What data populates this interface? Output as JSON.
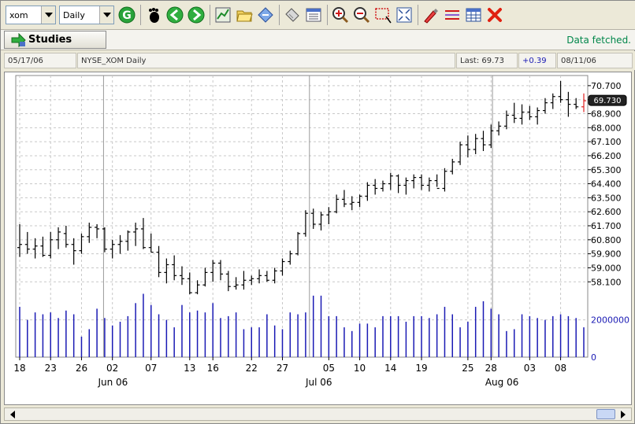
{
  "toolbar": {
    "symbol_value": "xom",
    "interval_value": "Daily"
  },
  "studies": {
    "label": "Studies"
  },
  "status": {
    "text": "Data fetched."
  },
  "info": {
    "start_date": "05/17/06",
    "title": "NYSE_XOM Daily",
    "last": "Last: 69.73",
    "change": "+0.39",
    "end_date": "08/11/06"
  },
  "colors": {
    "bar": "#000000",
    "last_bar": "#e02020",
    "volume": "#1a1ab4",
    "change": "#1a1ab4",
    "status": "#00864a"
  },
  "chart_data": {
    "type": "ohlc",
    "price_ticks": [
      "70.700",
      "69.800",
      "68.900",
      "68.000",
      "67.100",
      "66.200",
      "65.300",
      "64.400",
      "63.500",
      "62.600",
      "61.700",
      "60.800",
      "59.900",
      "59.000",
      "58.100"
    ],
    "price_range": [
      56.9,
      71.3
    ],
    "last_label": "69.730",
    "volume_ticks": [
      "2000000",
      "0"
    ],
    "volume_range": [
      0,
      3800000
    ],
    "day_labels": [
      "18",
      "23",
      "26",
      "02",
      "07",
      "13",
      "16",
      "22",
      "27",
      "05",
      "10",
      "14",
      "19",
      "25",
      "28",
      "03",
      "08"
    ],
    "month_labels": [
      "Jun 06",
      "Jul 06",
      "Aug 06"
    ],
    "bars": [
      [
        60.3,
        61.8,
        59.7,
        60.5
      ],
      [
        60.5,
        61.3,
        59.9,
        60.2
      ],
      [
        60.2,
        60.9,
        59.6,
        60.4
      ],
      [
        60.4,
        61.0,
        59.7,
        59.8
      ],
      [
        59.8,
        61.3,
        59.6,
        60.8
      ],
      [
        60.8,
        61.6,
        60.2,
        61.3
      ],
      [
        61.2,
        61.7,
        60.3,
        60.5
      ],
      [
        60.5,
        60.9,
        59.2,
        60.1
      ],
      [
        60.1,
        61.2,
        59.9,
        61.0
      ],
      [
        61.0,
        61.9,
        60.6,
        61.6
      ],
      [
        61.6,
        61.8,
        60.9,
        61.5
      ],
      [
        61.5,
        61.6,
        60.0,
        60.2
      ],
      [
        60.2,
        60.8,
        59.6,
        60.5
      ],
      [
        60.5,
        61.1,
        59.9,
        60.7
      ],
      [
        60.7,
        61.4,
        60.1,
        61.3
      ],
      [
        61.3,
        61.9,
        60.4,
        61.5
      ],
      [
        61.5,
        62.2,
        60.2,
        60.3
      ],
      [
        60.3,
        61.2,
        60.0,
        60.0
      ],
      [
        60.0,
        60.4,
        58.4,
        58.7
      ],
      [
        58.7,
        59.6,
        58.0,
        59.2
      ],
      [
        59.2,
        59.8,
        58.2,
        58.5
      ],
      [
        58.5,
        59.1,
        57.9,
        58.3
      ],
      [
        58.3,
        58.7,
        57.3,
        57.4
      ],
      [
        57.4,
        58.2,
        57.3,
        57.9
      ],
      [
        57.9,
        59.0,
        57.8,
        58.7
      ],
      [
        58.7,
        59.5,
        58.1,
        59.3
      ],
      [
        59.3,
        59.5,
        58.2,
        58.6
      ],
      [
        58.6,
        58.8,
        57.5,
        57.8
      ],
      [
        57.8,
        58.4,
        57.6,
        57.9
      ],
      [
        57.9,
        58.8,
        57.6,
        58.2
      ],
      [
        58.2,
        58.5,
        57.9,
        58.3
      ],
      [
        58.3,
        58.9,
        58.0,
        58.5
      ],
      [
        58.5,
        58.8,
        58.1,
        58.2
      ],
      [
        58.2,
        59.0,
        58.0,
        58.8
      ],
      [
        58.8,
        59.6,
        58.5,
        59.4
      ],
      [
        59.4,
        60.1,
        59.2,
        59.9
      ],
      [
        59.9,
        61.3,
        59.8,
        61.2
      ],
      [
        61.2,
        62.7,
        61.0,
        62.5
      ],
      [
        62.5,
        62.8,
        61.5,
        61.8
      ],
      [
        61.8,
        62.6,
        61.4,
        62.4
      ],
      [
        62.4,
        62.9,
        61.8,
        62.6
      ],
      [
        62.6,
        63.7,
        62.5,
        63.4
      ],
      [
        63.4,
        64.0,
        62.9,
        63.1
      ],
      [
        63.1,
        63.6,
        62.7,
        63.2
      ],
      [
        63.2,
        63.7,
        62.9,
        63.6
      ],
      [
        63.6,
        64.5,
        63.3,
        64.3
      ],
      [
        64.3,
        64.7,
        63.7,
        64.1
      ],
      [
        64.1,
        64.6,
        63.9,
        64.4
      ],
      [
        64.4,
        65.1,
        64.0,
        64.9
      ],
      [
        64.9,
        65.0,
        63.8,
        64.3
      ],
      [
        64.3,
        64.8,
        63.7,
        64.6
      ],
      [
        64.6,
        65.0,
        64.1,
        64.8
      ],
      [
        64.8,
        65.0,
        64.0,
        64.3
      ],
      [
        64.3,
        64.8,
        63.9,
        64.6
      ],
      [
        64.6,
        65.0,
        64.2,
        64.1
      ],
      [
        64.1,
        65.4,
        63.9,
        65.2
      ],
      [
        65.2,
        66.0,
        65.0,
        65.8
      ],
      [
        65.8,
        67.1,
        65.6,
        66.9
      ],
      [
        66.9,
        67.5,
        66.1,
        66.6
      ],
      [
        66.6,
        67.6,
        66.3,
        67.3
      ],
      [
        67.3,
        67.8,
        66.5,
        66.9
      ],
      [
        66.9,
        68.2,
        66.7,
        67.8
      ],
      [
        67.8,
        68.4,
        67.5,
        68.1
      ],
      [
        68.1,
        69.1,
        67.9,
        68.8
      ],
      [
        68.8,
        69.6,
        68.3,
        68.6
      ],
      [
        68.6,
        69.5,
        68.2,
        69.0
      ],
      [
        69.0,
        69.4,
        68.5,
        68.7
      ],
      [
        68.7,
        69.3,
        68.2,
        69.1
      ],
      [
        69.1,
        69.9,
        68.9,
        69.6
      ],
      [
        69.6,
        70.2,
        69.2,
        70.0
      ],
      [
        70.0,
        71.0,
        69.6,
        69.8
      ],
      [
        69.8,
        70.3,
        68.7,
        69.5
      ],
      [
        69.5,
        69.9,
        69.2,
        69.34
      ],
      [
        69.34,
        70.2,
        69.0,
        69.73
      ]
    ],
    "volume": [
      2.7,
      2.0,
      2.4,
      2.3,
      2.4,
      2.1,
      2.5,
      2.3,
      1.1,
      1.5,
      2.6,
      2.1,
      1.7,
      1.9,
      2.2,
      2.9,
      3.4,
      2.8,
      2.3,
      2.0,
      1.6,
      2.8,
      2.4,
      2.5,
      2.4,
      2.9,
      2.1,
      2.2,
      2.4,
      1.5,
      1.6,
      1.6,
      2.3,
      1.7,
      1.5,
      2.4,
      2.3,
      2.4,
      3.3,
      3.3,
      2.2,
      2.2,
      1.6,
      1.4,
      1.8,
      1.8,
      1.6,
      2.2,
      2.2,
      2.2,
      1.9,
      2.2,
      2.2,
      2.1,
      2.3,
      2.7,
      2.3,
      1.6,
      1.9,
      2.7,
      3.0,
      2.6,
      2.3,
      1.4,
      1.5,
      2.3,
      2.2,
      2.1,
      2.0,
      2.2,
      2.3,
      2.2,
      2.1,
      1.6
    ]
  }
}
